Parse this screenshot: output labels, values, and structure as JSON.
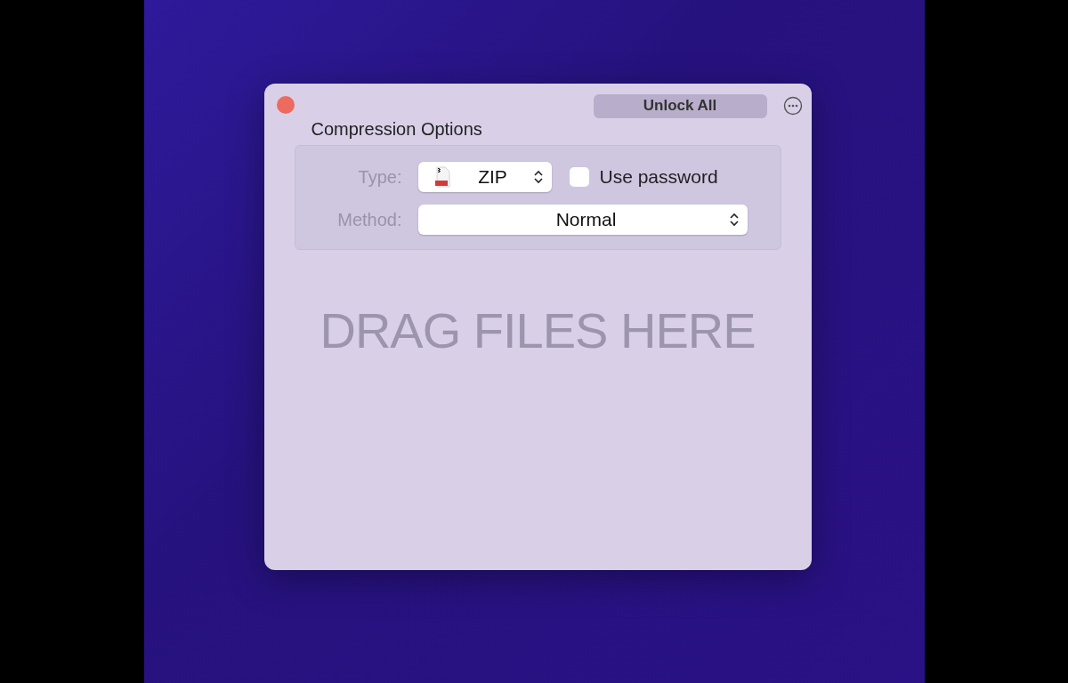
{
  "window": {
    "action_button": "Unlock All"
  },
  "compression_options": {
    "title": "Compression Options",
    "type": {
      "label": "Type:",
      "value": "ZIP"
    },
    "use_password": {
      "label": "Use password",
      "checked": false
    },
    "method": {
      "label": "Method:",
      "value": "Normal"
    }
  },
  "drop_zone": {
    "text": "DRAG FILES HERE"
  }
}
